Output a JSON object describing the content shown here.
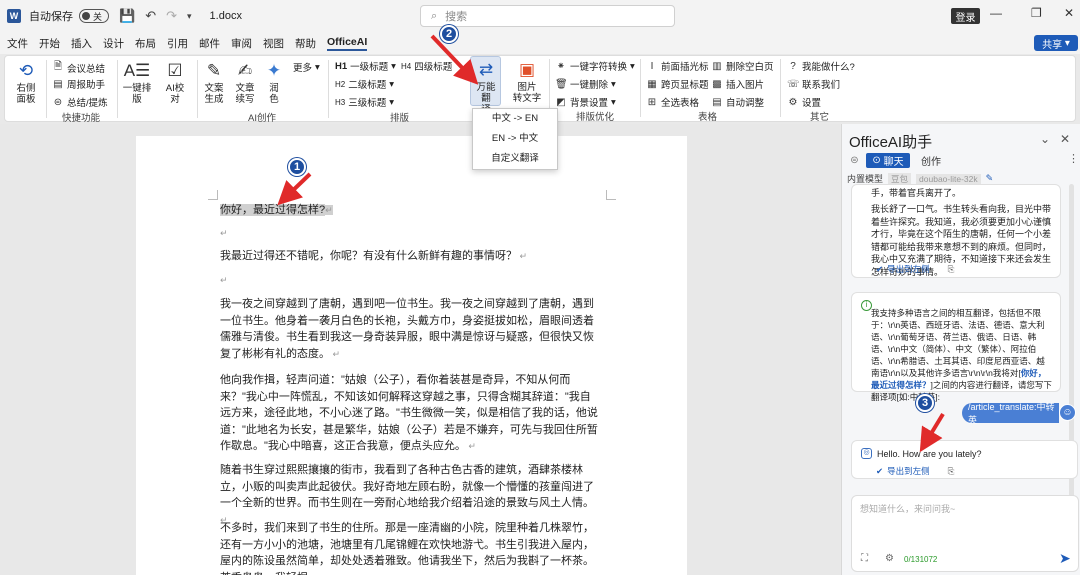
{
  "titlebar": {
    "app_icon": "W",
    "autosave_label": "自动保存",
    "autosave_state": "关",
    "doc_name": "1.docx",
    "search_placeholder": "搜索",
    "login_label": "登录"
  },
  "menu": {
    "items": [
      "文件",
      "开始",
      "插入",
      "设计",
      "布局",
      "引用",
      "邮件",
      "审阅",
      "视图",
      "帮助",
      "OfficeAI"
    ],
    "share_label": "共享"
  },
  "ribbon": {
    "right_panel": "右侧\n面板",
    "meeting_summary": "会议总结",
    "weekly_report": "周报助手",
    "summary_extract": "总结/提炼",
    "group_quick": "快捷功能",
    "one_click_layout": "一键排\n版",
    "ai_proofread": "AI校\n对",
    "article_gen": "文案\n生成",
    "article_continue": "文章\n续写",
    "polish": "润\n色",
    "more": "更多",
    "group_ai": "AI创作",
    "h1": "一级标题",
    "h2": "二级标题",
    "h3": "三级标题",
    "h4": "四级标题",
    "group_layout": "排版",
    "translate": "万能翻\n译",
    "img_to_text": "图片\n转文字",
    "one_click_symbol": "一键字符转换",
    "one_click_delete": "一键删除",
    "bg_settings": "背景设置",
    "group_optimize": "排版优化",
    "cursor_front": "前面插光标",
    "del_blank_row": "删除空白页",
    "cross_page_table": "跨页显标题",
    "insert_image": "插入图片",
    "select_table": "全选表格",
    "auto_adjust": "自动调整",
    "group_table": "表格",
    "what_can_i_do": "我能做什么?",
    "contact_us": "联系我们",
    "settings": "设置",
    "group_other": "其它"
  },
  "dropdown": {
    "items": [
      "中文 -> EN",
      "EN -> 中文",
      "自定义翻译"
    ]
  },
  "document": {
    "line1": "你好，最近过得怎样?",
    "para2": "我最近过得还不错呢，你呢？有没有什么新鲜有趣的事情呀？",
    "para3": "我一夜之间穿越到了唐朝，遇到吧一位书生。我一夜之间穿越到了唐朝，遇到一位书生。他身着一袭月白色的长袍，头戴方巾，身姿挺拔如松，眉眼间透着儒雅与清俊。书生看到我这一身奇装异服，眼中满是惊讶与疑惑，但很快又恢复了彬彬有礼的态度。",
    "para4": "他向我作揖，轻声问道：\"姑娘（公子），看你着装甚是奇异，不知从何而来？\"我心中一阵慌乱，不知该如何解释这穿越之事，只得含糊其辞道：\"我自远方来，途径此地，不小心迷了路。\"书生微微一笑，似是相信了我的话，他说道：\"此地名为长安，甚是繁华，姑娘（公子）若是不嫌弃，可先与我回住所暂作歇息。\"我心中暗喜，这正合我意，便点头应允。",
    "para5": "随着书生穿过熙熙攘攘的街市，我看到了各种古色古香的建筑，酒肆茶楼林立，小贩的叫卖声此起彼伏。我好奇地左顾右盼，就像一个懵懂的孩童闯进了一个全新的世界。而书生则在一旁耐心地给我介绍着沿途的景致与风土人情。",
    "para6": "不多时，我们来到了书生的住所。那是一座清幽的小院，院里种着几株翠竹，还有一方小小的池塘，池塘里有几尾锦鲤在欢快地游弋。书生引我进入屋内，屋内的陈设虽然简单，却处处透着雅致。他请我坐下，然后为我斟了一杯茶。茶香袅袅，我轻抿一"
  },
  "panel": {
    "title": "OfficeAI助手",
    "tab_chat": "聊天",
    "tab_create": "创作",
    "model_label": "内置模型",
    "model_tag": "豆包",
    "model_name": "doubao-lite-32k",
    "card1_line0": "手，带着官兵离开了。",
    "card1_text": "我长舒了一口气。书生转头看向我，目光中带着些许探究。我知道，我必须要更加小心谨慎才行，毕竟在这个陌生的唐朝，任何一个小差错都可能给我带来意想不到的麻烦。但同时，我心中又充满了期待，不知道接下来还会发生怎样奇妙的事情。",
    "export_label": "导出到左侧",
    "card2_text": "我支持多种语言之间的相互翻译，包括但不限于：\\r\\n英语、西班牙语、法语、德语、意大利语、\\r\\n葡萄牙语、荷兰语、俄语、日语、韩语、\\r\\n中文（简体）、中文（繁体）、阿拉伯语、\\r\\n希腊语、土耳其语、印度尼西亚语、越南语\\r\\n以及其他许多语言\\r\\n\\r\\n我将对[",
    "card2_hl": "你好，最近过得怎样？",
    "card2_tail": "]之间的内容进行翻译，请您写下翻译项[如:中转英]:",
    "user_msg": "/article_translate:中转英",
    "card3_text": "Hello. How are you lately?",
    "input_placeholder": "想知道什么，来问问我~",
    "char_count": "0/131072"
  },
  "badges": [
    "1",
    "2",
    "3"
  ],
  "colors": {
    "accent": "#1e4e9f",
    "arrow": "#e02a2a",
    "user_bubble": "#4a7fd4"
  }
}
